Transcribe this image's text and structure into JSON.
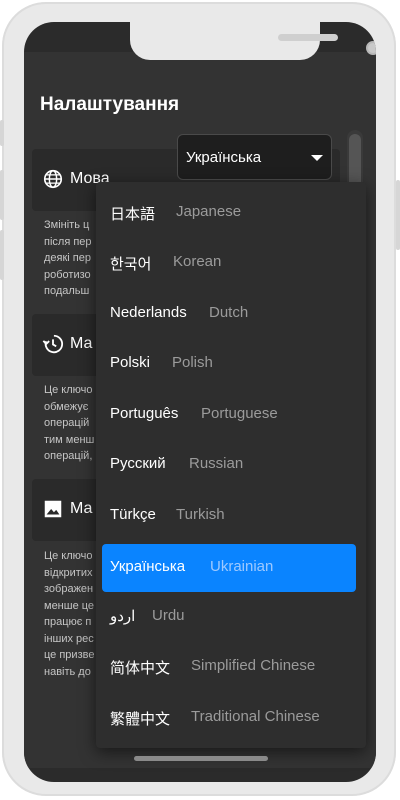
{
  "settings": {
    "title": "Налаштування",
    "language": {
      "label": "Мова",
      "selected": "Українська",
      "desc_lines": [
        "Змініть ц",
        "після пер",
        "деякі пер",
        "роботизо",
        "подальш"
      ]
    },
    "history": {
      "label": "Ма",
      "desc_lines": [
        "Це ключо",
        "обмежує",
        "операцій",
        "тим менш",
        "операцій,"
      ]
    },
    "images": {
      "label": "Ма",
      "desc_lines": [
        "Це ключо",
        "відкритих",
        "зображен",
        "менше це",
        "працює п",
        "інших рес",
        "це призве",
        "навіть до"
      ]
    }
  },
  "dropdown": {
    "options": [
      {
        "native": "日本語",
        "english": "Japanese"
      },
      {
        "native": "한국어",
        "english": "Korean"
      },
      {
        "native": "Nederlands",
        "english": "Dutch"
      },
      {
        "native": "Polski",
        "english": "Polish"
      },
      {
        "native": "Português",
        "english": "Portuguese"
      },
      {
        "native": "Русский",
        "english": "Russian"
      },
      {
        "native": "Türkçe",
        "english": "Turkish"
      },
      {
        "native": "Українська",
        "english": "Ukrainian"
      },
      {
        "native": "اردو",
        "english": "Urdu"
      },
      {
        "native": "简体中文",
        "english": "Simplified Chinese"
      },
      {
        "native": "繁體中文",
        "english": "Traditional Chinese"
      }
    ],
    "selected_index": 7
  },
  "colors": {
    "accent": "#0a84ff",
    "background": "#333333",
    "card": "#2a2a2a"
  },
  "icons": {
    "language": "globe-icon",
    "history": "history-icon",
    "images": "image-icon",
    "dropdown": "chevron-down-icon"
  }
}
